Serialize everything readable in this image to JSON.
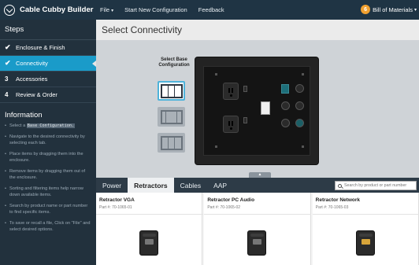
{
  "app": {
    "title": "Cable Cubby Builder",
    "menu": [
      {
        "label": "File",
        "has_caret": true
      },
      {
        "label": "Start New Configuration"
      },
      {
        "label": "Feedback"
      }
    ],
    "bom_count": "6",
    "bom_label": "Bill of Materials"
  },
  "sidebar": {
    "steps_title": "Steps",
    "steps": [
      {
        "marker": "✔",
        "label": "Enclosure & Finish",
        "state": "done"
      },
      {
        "marker": "✔",
        "label": "Connectivity",
        "state": "active"
      },
      {
        "marker": "3",
        "label": "Accessories",
        "state": "todo"
      },
      {
        "marker": "4",
        "label": "Review & Order",
        "state": "todo"
      }
    ],
    "info_title": "Information",
    "info": {
      "item0_pre": "Select a ",
      "item0_code": "Base Configuration.",
      "item1": "Navigate to the desired connectivity by selecting each tab.",
      "item2": "Place items by dragging them into the enclosure.",
      "item3": "Remove items by dragging them out of the enclosure.",
      "item4": "Sorting and filtering items help narrow down available items.",
      "item5": "Search by product name or part number to find specific items.",
      "item6": "To save or recall a file, Click on \"File\" and select desired options."
    }
  },
  "main": {
    "page_title": "Select Connectivity",
    "config_label": "Select Base Configuration",
    "tabs": [
      {
        "label": "Power",
        "active": false
      },
      {
        "label": "Retractors",
        "active": true
      },
      {
        "label": "Cables",
        "active": false
      },
      {
        "label": "AAP",
        "active": false
      }
    ],
    "search_placeholder": "Search by product or part number",
    "products": [
      {
        "name": "Retractor VGA",
        "part": "Part #: 70-1065-01"
      },
      {
        "name": "Retractor PC Audio",
        "part": "Part #: 70-1065-02"
      },
      {
        "name": "Retractor Network",
        "part": "Part #: 70-1065-03"
      }
    ]
  },
  "colors": {
    "topbar": "#1f3444",
    "sidebar": "#22313d",
    "accent": "#1a9bc9",
    "badge": "#f0a030"
  }
}
